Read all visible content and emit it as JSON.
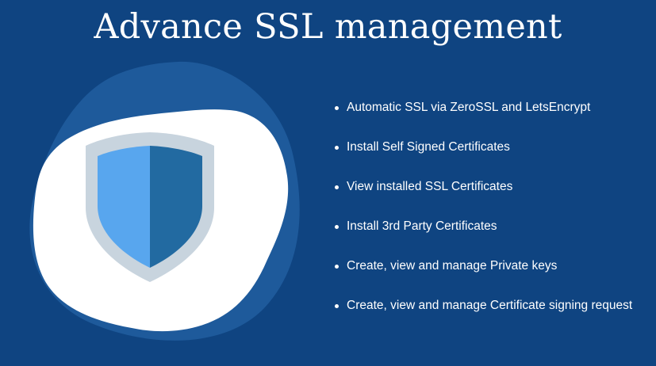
{
  "title": "Advance SSL management",
  "colors": {
    "background": "#0f4481",
    "back_blob": "#1e5a9b",
    "front_blob": "#ffffff",
    "shield_border": "#c8d4de",
    "shield_left": "#58a6ee",
    "shield_right": "#226aa1",
    "text": "#ffffff"
  },
  "illustration": {
    "icon": "shield-icon"
  },
  "features": [
    "Automatic SSL via ZeroSSL and LetsEncrypt",
    "Install Self Signed Certificates",
    "View installed SSL Certificates",
    "Install 3rd Party Certificates",
    "Create, view and manage Private keys",
    "Create, view and manage Certificate signing request"
  ]
}
